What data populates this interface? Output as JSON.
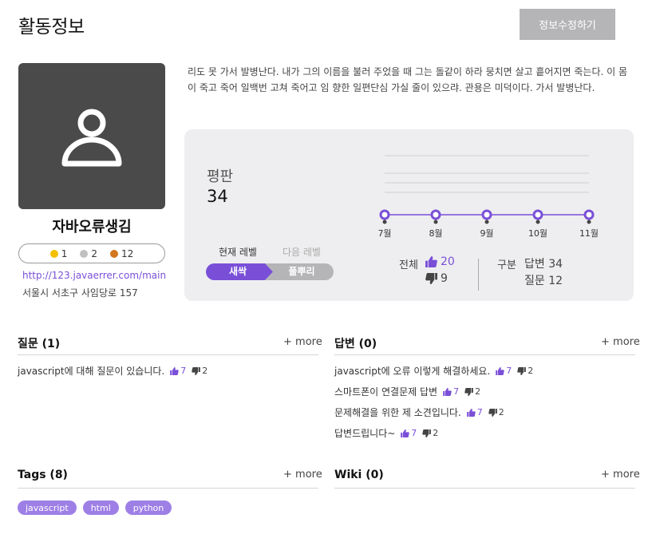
{
  "header": {
    "title": "활동정보",
    "edit_label": "정보수정하기"
  },
  "profile": {
    "username": "자바오류생김",
    "badges": [
      {
        "count": "1",
        "color": "#f5c000"
      },
      {
        "count": "2",
        "color": "#c0c0c0"
      },
      {
        "count": "12",
        "color": "#d2761f"
      }
    ],
    "link": "http://123.javaerrer.com/main",
    "address": "서울시 서초구 사임당로 157",
    "icon": "user-icon"
  },
  "bio": "리도 못 가서 발병난다. 내가 그의 이름을 불러 주었을 때 그는 돌같이 하라 뭉치면 살고 흩어지면 죽는다. 이 몸이 죽고 죽어 일백번 고쳐 죽어고 임 향한 일편단심 가실 줄이 있으랴. 관용은 미덕이다. 가서 발병난다.",
  "reputation": {
    "label": "평판",
    "value": "34",
    "current_level_label": "현재 레벨",
    "next_level_label": "다음 레벨",
    "current_level": "새싹",
    "next_level": "풀뿌리",
    "accent": "#7a4fd8"
  },
  "chart_data": {
    "type": "line",
    "categories": [
      "7월",
      "8월",
      "9월",
      "10월",
      "11월"
    ],
    "values": [
      0,
      0,
      0,
      0,
      0
    ]
  },
  "totals": {
    "label": "전체",
    "up": "20",
    "down": "9",
    "category_label": "구분",
    "answers": "답변 34",
    "questions": "질문 12"
  },
  "questions": {
    "title": "질문 (1)",
    "more": "+ more",
    "items": [
      {
        "text": "javascript에 대해 질문이 있습니다.",
        "up": "7",
        "down": "2"
      }
    ]
  },
  "answers": {
    "title": "답변 (0)",
    "more": "+ more",
    "items": [
      {
        "text": "javascript에 오류 이렇게 해결하세요.",
        "up": "7",
        "down": "2"
      },
      {
        "text": "스마트폰이 연결문제 답변",
        "up": "7",
        "down": "2"
      },
      {
        "text": "문제해결을 위한 제 소견입니다.",
        "up": "7",
        "down": "2"
      },
      {
        "text": "답변드립니다~",
        "up": "7",
        "down": "2"
      }
    ]
  },
  "tags": {
    "title": "Tags (8)",
    "more": "+ more",
    "items": [
      "javascript",
      "html",
      "python"
    ]
  },
  "wiki": {
    "title": "Wiki (0)",
    "more": "+ more"
  }
}
